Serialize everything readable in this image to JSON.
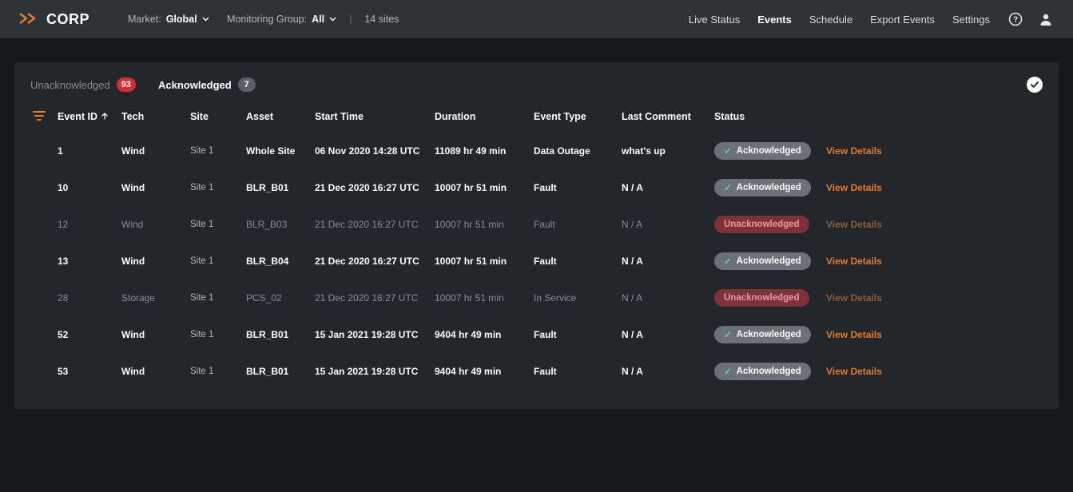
{
  "brand": "CORP",
  "nav": {
    "market_label": "Market:",
    "market_value": "Global",
    "group_label": "Monitoring Group:",
    "group_value": "All",
    "sites_count": "14 sites",
    "links": {
      "live_status": "Live Status",
      "events": "Events",
      "schedule": "Schedule",
      "export": "Export Events",
      "settings": "Settings"
    }
  },
  "tabs": {
    "unack_label": "Unacknowledged",
    "unack_count": "93",
    "ack_label": "Acknowledged",
    "ack_count": "7"
  },
  "columns": {
    "event_id": "Event ID",
    "tech": "Tech",
    "site": "Site",
    "asset": "Asset",
    "start": "Start Time",
    "duration": "Duration",
    "etype": "Event Type",
    "comment": "Last Comment",
    "status": "Status"
  },
  "status_labels": {
    "ack": "Acknowledged",
    "unack": "Unacknowledged"
  },
  "view_details": "View Details",
  "rows": [
    {
      "id": "1",
      "tech": "Wind",
      "site": "Site 1",
      "asset": "Whole Site",
      "start": "06 Nov 2020 14:28 UTC",
      "duration": "11089 hr 49 min",
      "etype": "Data Outage",
      "comment": "what's up",
      "status": "ack",
      "dim": false
    },
    {
      "id": "10",
      "tech": "Wind",
      "site": "Site 1",
      "asset": "BLR_B01",
      "start": "21 Dec 2020 16:27 UTC",
      "duration": "10007 hr 51 min",
      "etype": "Fault",
      "comment": "N / A",
      "status": "ack",
      "dim": false
    },
    {
      "id": "12",
      "tech": "Wind",
      "site": "Site 1",
      "asset": "BLR_B03",
      "start": "21 Dec 2020 16:27 UTC",
      "duration": "10007 hr 51 min",
      "etype": "Fault",
      "comment": "N / A",
      "status": "unack",
      "dim": true
    },
    {
      "id": "13",
      "tech": "Wind",
      "site": "Site 1",
      "asset": "BLR_B04",
      "start": "21 Dec 2020 16:27 UTC",
      "duration": "10007 hr 51 min",
      "etype": "Fault",
      "comment": "N / A",
      "status": "ack",
      "dim": false
    },
    {
      "id": "28",
      "tech": "Storage",
      "site": "Site 1",
      "asset": "PCS_02",
      "start": "21 Dec 2020 16:27 UTC",
      "duration": "10007 hr 51 min",
      "etype": "In Service",
      "comment": "N / A",
      "status": "unack",
      "dim": true
    },
    {
      "id": "52",
      "tech": "Wind",
      "site": "Site 1",
      "asset": "BLR_B01",
      "start": "15 Jan 2021 19:28 UTC",
      "duration": "9404 hr 49 min",
      "etype": "Fault",
      "comment": "N / A",
      "status": "ack",
      "dim": false
    },
    {
      "id": "53",
      "tech": "Wind",
      "site": "Site 1",
      "asset": "BLR_B01",
      "start": "15 Jan 2021 19:28 UTC",
      "duration": "9404 hr 49 min",
      "etype": "Fault",
      "comment": "N / A",
      "status": "ack",
      "dim": false
    }
  ]
}
